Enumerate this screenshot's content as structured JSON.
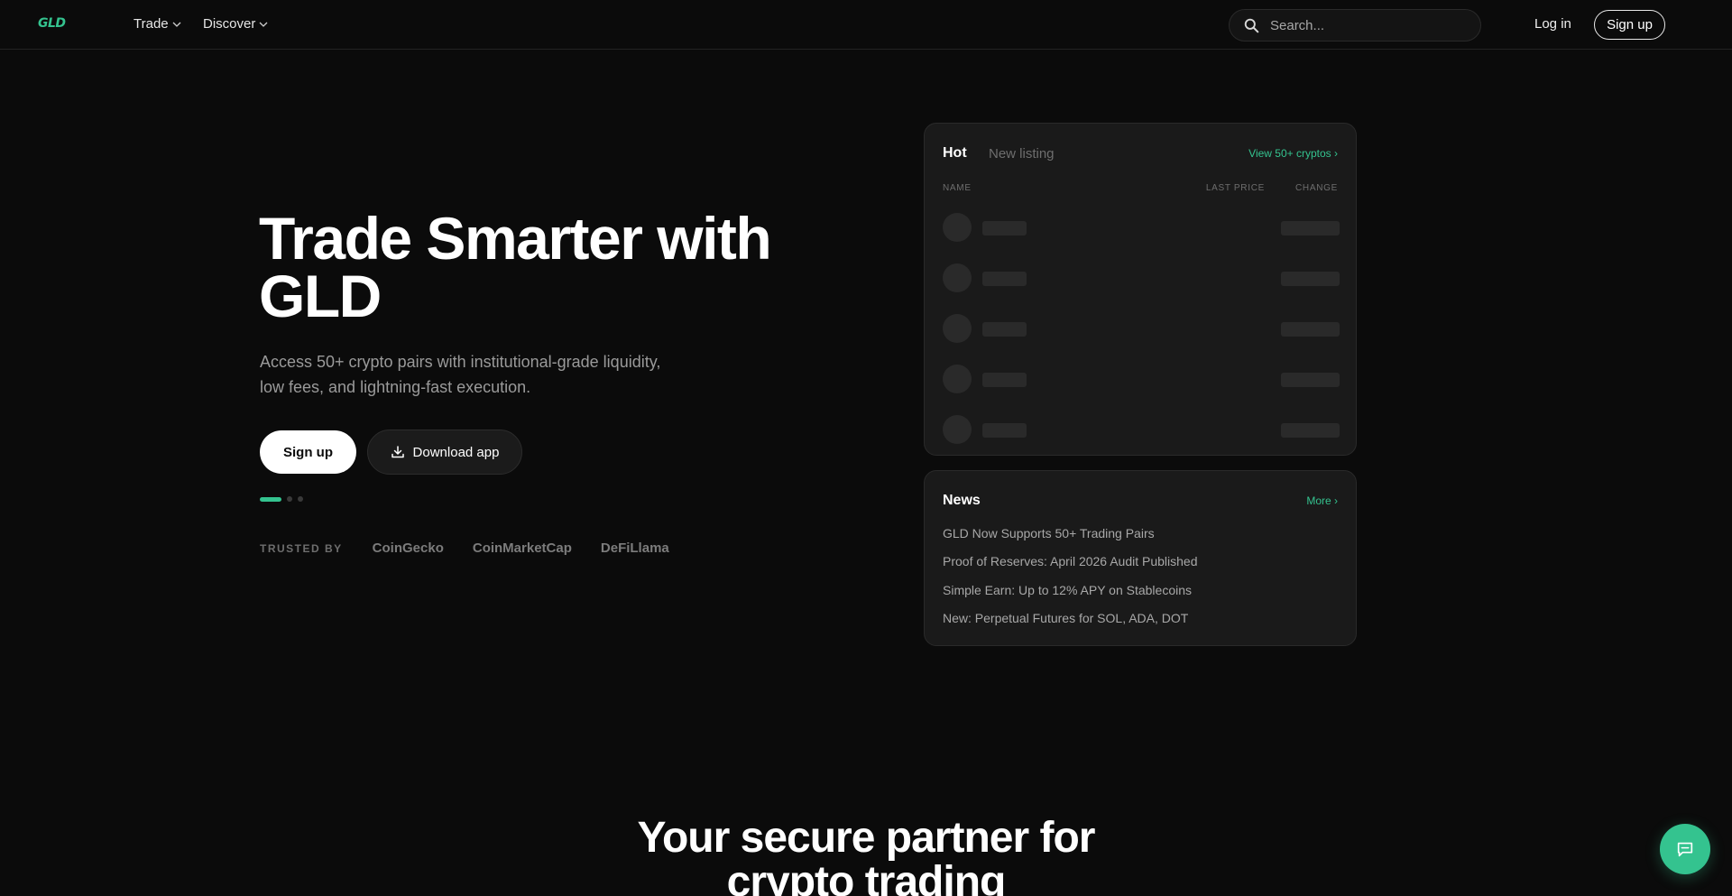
{
  "header": {
    "logo": "GLD",
    "nav": [
      {
        "label": "Trade"
      },
      {
        "label": "Discover"
      }
    ],
    "search_placeholder": "Search...",
    "login_label": "Log in",
    "signup_label": "Sign up"
  },
  "hero": {
    "title_line1": "Trade Smarter with",
    "title_line2": "GLD",
    "subtitle_line1": "Access 50+ crypto pairs with institutional-grade liquidity,",
    "subtitle_line2": "low fees, and lightning-fast execution.",
    "signup_label": "Sign up",
    "download_label": "Download app",
    "carousel": {
      "active_index": 0,
      "total": 3
    },
    "trusted_label": "TRUSTED BY",
    "trusted": [
      "CoinGecko",
      "CoinMarketCap",
      "DeFiLlama"
    ]
  },
  "market": {
    "tabs": [
      "Hot",
      "New listing"
    ],
    "active_tab": "Hot",
    "view_link": "View 50+ cryptos ›",
    "columns": {
      "name": "NAME",
      "last_price": "LAST PRICE",
      "change": "CHANGE"
    },
    "rows_loading": 5
  },
  "news": {
    "title": "News",
    "more_link": "More ›",
    "items": [
      "GLD Now Supports 50+ Trading Pairs",
      "Proof of Reserves: April 2026 Audit Published",
      "Simple Earn: Up to 12% APY on Stablecoins",
      "New: Perpetual Futures for SOL, ADA, DOT"
    ]
  },
  "section": {
    "title_line1": "Your secure partner for",
    "title_line2": "crypto trading"
  },
  "colors": {
    "accent": "#34c38f",
    "background": "#0b0b0b",
    "card": "#1a1a1a"
  },
  "icons": {
    "search": "search-icon",
    "chevron": "chevron-down-icon",
    "download": "download-icon",
    "chat": "chat-icon"
  }
}
